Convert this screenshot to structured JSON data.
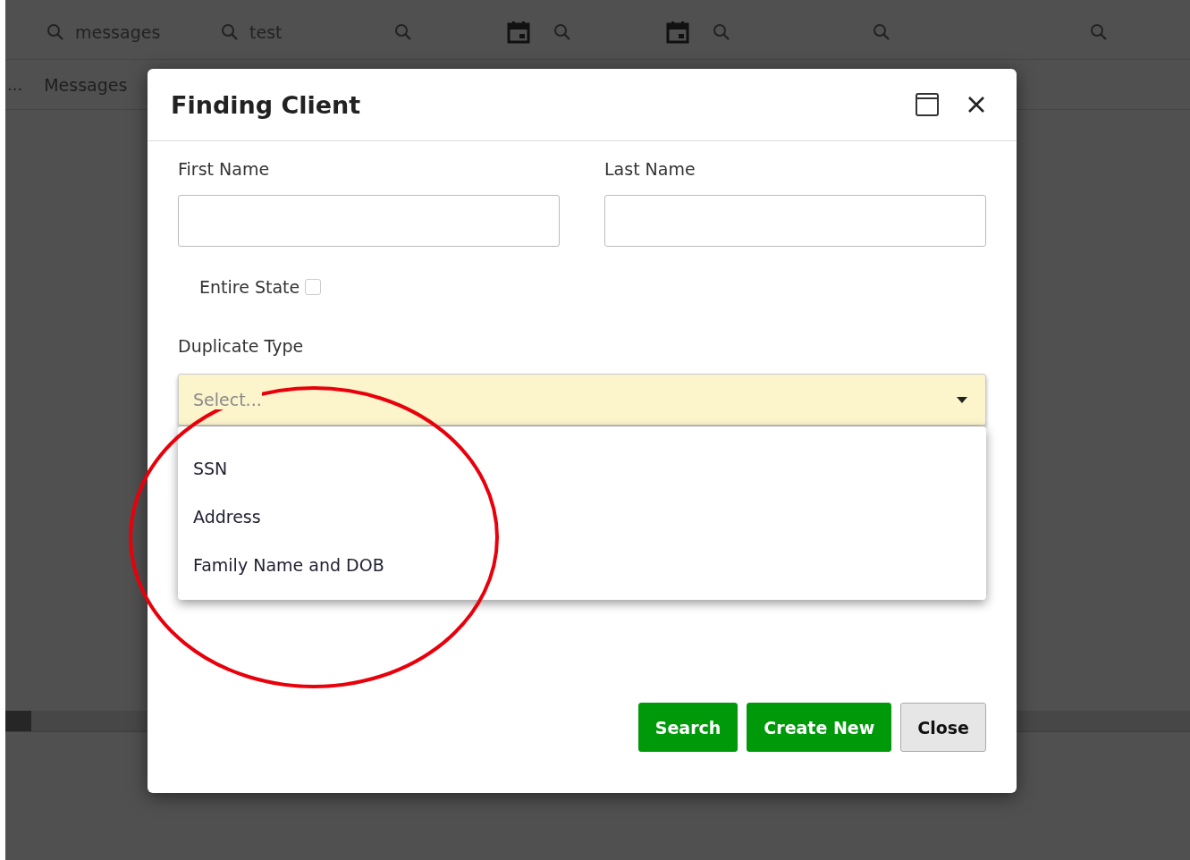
{
  "filters": [
    {
      "kind": "text",
      "value": "messages"
    },
    {
      "kind": "text",
      "value": "test"
    },
    {
      "kind": "date"
    },
    {
      "kind": "date"
    },
    {
      "kind": "text"
    },
    {
      "kind": "text"
    },
    {
      "kind": "text"
    }
  ],
  "grid_row": {
    "ellipsis": "...",
    "cell": "Messages"
  },
  "dialog": {
    "title": "Finding Client",
    "first_name": {
      "label": "First Name"
    },
    "last_name": {
      "label": "Last Name"
    },
    "entire_state": {
      "label": "Entire State",
      "checked": false
    },
    "duplicate_type": {
      "label": "Duplicate Type",
      "placeholder": "Select...",
      "expanded": true,
      "options": [
        {
          "label": "SSN",
          "selected": false
        },
        {
          "label": "Address",
          "selected": false
        },
        {
          "label": "Family Name and DOB",
          "selected": false
        }
      ]
    },
    "buttons": [
      {
        "label": "Search",
        "kind": "primary"
      },
      {
        "label": "Create New",
        "kind": "primary"
      },
      {
        "label": "Close",
        "kind": "secondary"
      }
    ]
  }
}
